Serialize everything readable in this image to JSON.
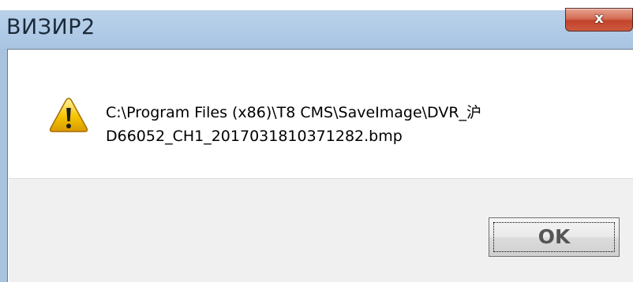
{
  "window": {
    "title": "ВИЗИР2",
    "close_icon": "close-icon",
    "close_glyph": "x"
  },
  "dialog": {
    "icon": "warning-icon",
    "message_lines": [
      "C:\\Program Files (x86)\\T8 CMS\\SaveImage\\DVR_沪",
      "D66052_CH1_2017031810371282.bmp"
    ]
  },
  "buttons": {
    "ok_label": "OK"
  },
  "colors": {
    "titlebar": "#b6cfe9",
    "close_button": "#c2432a",
    "warning_fill": "#f5c400",
    "button_area": "#f0f0f0"
  }
}
